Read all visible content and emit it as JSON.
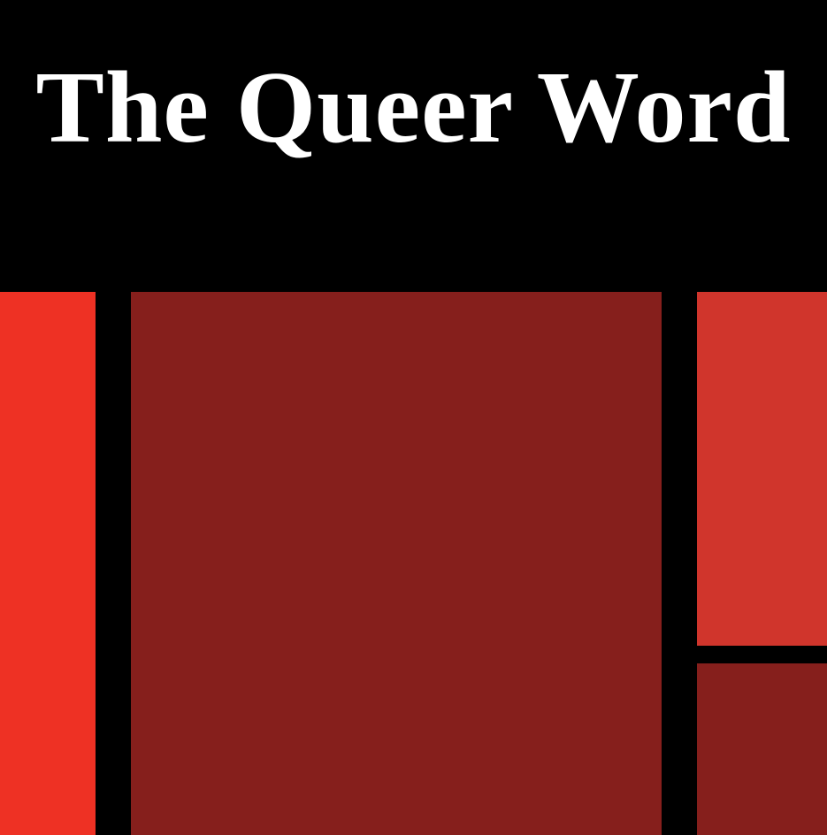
{
  "header": {
    "title": "The Queer Word"
  },
  "colors": {
    "background": "#000000",
    "title": "#ffffff",
    "block_left": "#EE3124",
    "block_center": "#861F1C",
    "block_right_top": "#D0352C",
    "block_right_bottom": "#861F1C"
  }
}
